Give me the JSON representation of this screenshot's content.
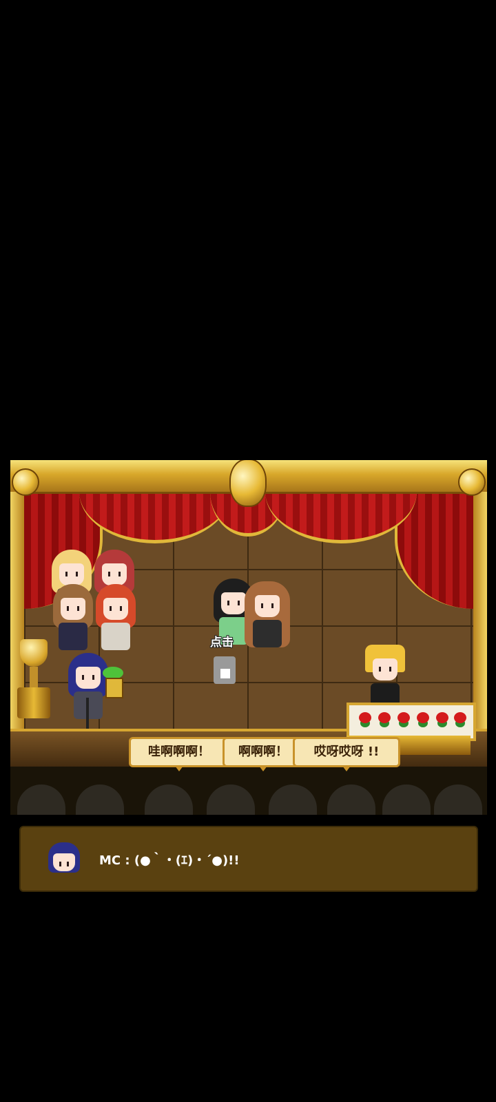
{
  "stage": {
    "tap_hint": "点击",
    "bubbles": [
      {
        "text": "哇啊啊啊！"
      },
      {
        "text": "啊啊啊！"
      },
      {
        "text": "哎呀哎呀 !!"
      }
    ]
  },
  "dialogue": {
    "speaker_text": "MC : (●｀・(ｴ)・´●)!!"
  },
  "colors": {
    "gold": "#d6a631",
    "curtain_red": "#b51616",
    "dialog_bg": "#5a4110"
  },
  "icons": [
    "trophy-icon",
    "microphone-icon",
    "plant-icon",
    "cat-icon",
    "flower-box-icon"
  ]
}
